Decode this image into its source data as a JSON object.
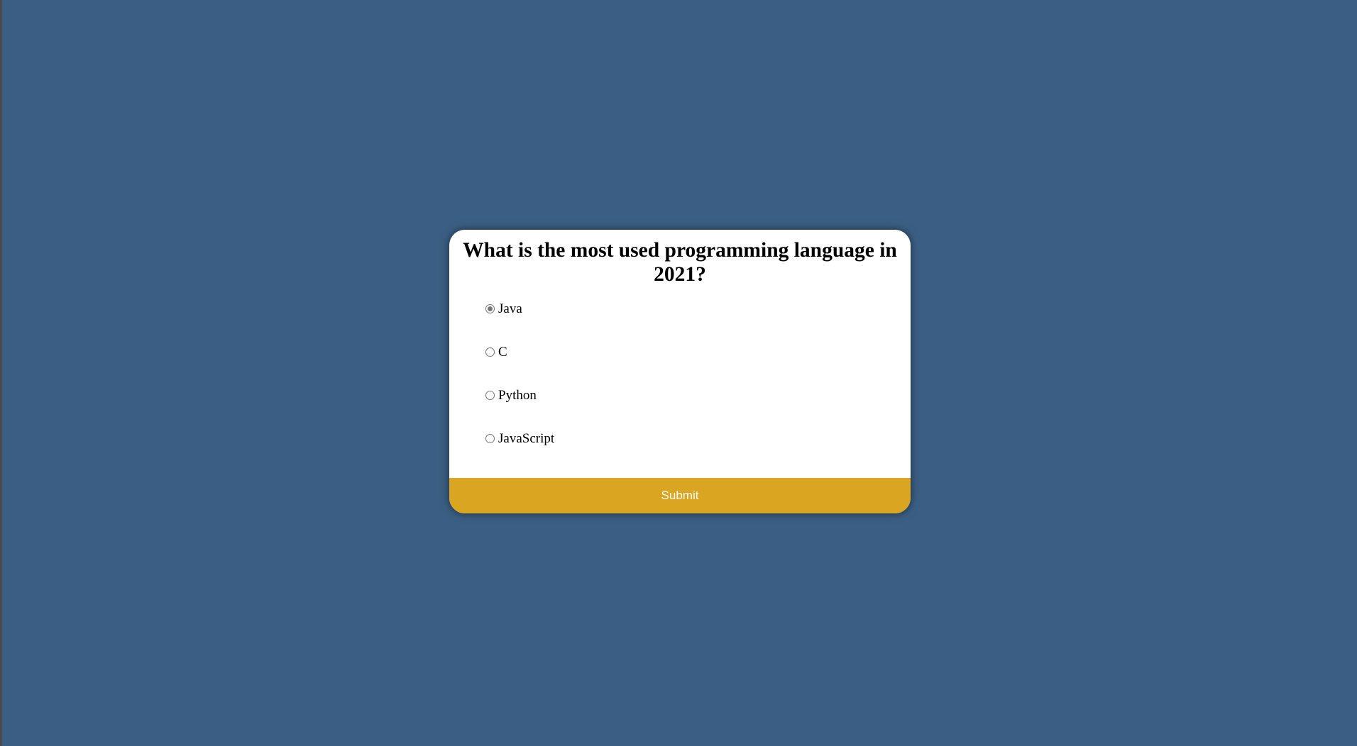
{
  "quiz": {
    "question": "What is the most used programming language in 2021?",
    "answers": [
      {
        "label": "Java",
        "checked": true
      },
      {
        "label": "C",
        "checked": false
      },
      {
        "label": "Python",
        "checked": false
      },
      {
        "label": "JavaScript",
        "checked": false
      }
    ],
    "submit_label": "Submit"
  },
  "colors": {
    "page_background": "#3b5f84",
    "card_background": "#ffffff",
    "submit_background": "#daa520",
    "submit_text": "#ffffff"
  },
  "icons": {
    "radio_checked": "radio-checked-icon",
    "radio_unchecked": "radio-unchecked-icon"
  }
}
